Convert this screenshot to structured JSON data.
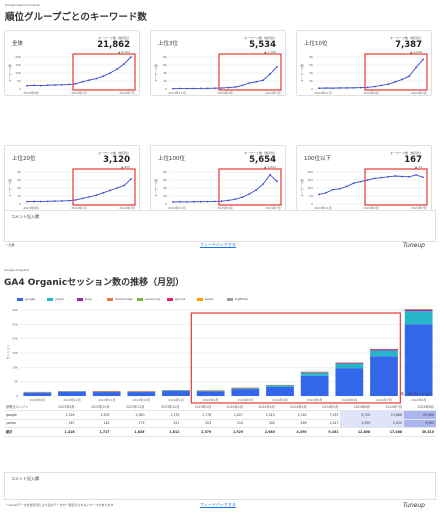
{
  "top": {
    "tag": "Google Search Console",
    "title": "順位グループごとのキーワード数",
    "comment_label": "コメント記入欄",
    "footnote": "* 出典",
    "feedback": "フィードバックする",
    "logo": "Tuneup"
  },
  "cards": [
    {
      "title": "全体",
      "kpi_label": "キーワード数（前月比）",
      "value": "21,862",
      "delta": "▲ 6,253",
      "ylabel": "キーワード数",
      "xticks": [
        "2023年8月",
        "2024年1月",
        "2024年7月"
      ],
      "yticks": [
        "20K",
        "15K",
        "10K",
        "5K",
        "0"
      ]
    },
    {
      "title": "上位3位",
      "kpi_label": "キーワード数（前月比）",
      "value": "5,534",
      "delta": "▲ 1,785",
      "ylabel": "キーワード数",
      "xticks": [
        "2023年11月",
        "2024年3月",
        "2024年7月"
      ],
      "yticks": [
        "8K",
        "6K",
        "4K",
        "2K",
        "0"
      ]
    },
    {
      "title": "上位10位",
      "kpi_label": "キーワード数（前月比）",
      "value": "7,387",
      "delta": "▲ 1,998",
      "ylabel": "キーワード数",
      "xticks": [
        "2023年11月",
        "2024年3月",
        "2024年7月"
      ],
      "yticks": [
        "8K",
        "6K",
        "4K",
        "2K",
        "0"
      ]
    },
    {
      "title": "上位20位",
      "kpi_label": "キーワード数（前月比）",
      "value": "3,120",
      "delta": "▲ 815",
      "ylabel": "キーワード数",
      "xticks": [
        "2023年8月",
        "2024年1月",
        "2024年7月"
      ],
      "yticks": [
        "4K",
        "3K",
        "2K",
        "1K",
        "0"
      ]
    },
    {
      "title": "上位100位",
      "kpi_label": "キーワード数（前月比）",
      "value": "5,654",
      "delta": "▲ 1,641",
      "ylabel": "キーワード数",
      "xticks": [
        "2023年11月",
        "2024年3月",
        "2024年7月"
      ],
      "yticks": [
        "8K",
        "6K",
        "4K",
        "2K",
        "0"
      ]
    },
    {
      "title": "100位以下",
      "kpi_label": "キーワード数（前月比）",
      "value": "167",
      "delta": "▲ 15",
      "ylabel": "キーワード数",
      "xticks": [
        "2023年11月",
        "2024年3月",
        "2024年7月"
      ],
      "yticks": [
        "200",
        "150",
        "100",
        "50",
        "0"
      ]
    }
  ],
  "chart_data": [
    {
      "type": "line",
      "title": "全体",
      "ylim": [
        0,
        20000
      ],
      "values": [
        2000,
        2300,
        2100,
        2400,
        2500,
        2600,
        2800,
        3200,
        4500,
        5600,
        6500,
        8000,
        10000,
        12500,
        15600,
        21862
      ]
    },
    {
      "type": "line",
      "title": "上位3位",
      "ylim": [
        0,
        8000
      ],
      "values": [
        100,
        120,
        110,
        130,
        150,
        160,
        200,
        250,
        350,
        500,
        900,
        1500,
        1800,
        2200,
        3749,
        5534
      ]
    },
    {
      "type": "line",
      "title": "上位10位",
      "ylim": [
        0,
        8000
      ],
      "values": [
        200,
        250,
        220,
        260,
        280,
        300,
        350,
        400,
        600,
        900,
        1200,
        1800,
        2400,
        3200,
        5389,
        7387
      ]
    },
    {
      "type": "line",
      "title": "上位20位",
      "ylim": [
        0,
        4000
      ],
      "values": [
        300,
        320,
        310,
        330,
        360,
        380,
        420,
        500,
        700,
        900,
        1100,
        1400,
        1700,
        2000,
        2305,
        3120
      ]
    },
    {
      "type": "line",
      "title": "上位100位",
      "ylim": [
        0,
        8000
      ],
      "values": [
        500,
        550,
        520,
        560,
        580,
        600,
        650,
        700,
        900,
        1200,
        1700,
        2500,
        3500,
        5000,
        7295,
        5654
      ]
    },
    {
      "type": "line",
      "title": "100位以下",
      "ylim": [
        0,
        200
      ],
      "values": [
        60,
        70,
        90,
        95,
        110,
        130,
        140,
        150,
        160,
        165,
        170,
        175,
        172,
        170,
        182,
        167
      ]
    },
    {
      "type": "bar",
      "title": "GA4 Organicセッション数の推移（月別）",
      "categories": [
        "2023年9月",
        "2023年10月",
        "2023年11月",
        "2023年12月",
        "2024年1月",
        "2024年2月",
        "2024年3月",
        "2024年4月",
        "2024年5月",
        "2024年6月",
        "2024年7月",
        "2024年8月"
      ],
      "ylim": [
        0,
        30000
      ],
      "yticks": [
        "30K",
        "25K",
        "20K",
        "15K",
        "10K",
        "5K",
        "0"
      ],
      "ylabel": "セッション",
      "series": [
        {
          "name": "google",
          "color": "#3366e8",
          "values": [
            1159,
            1503,
            1380,
            1375,
            1778,
            1627,
            2415,
            3183,
            7033,
            9720,
            13866,
            25000
          ]
        },
        {
          "name": "yahoo",
          "color": "#26b5c9",
          "values": [
            167,
            142,
            175,
            151,
            203,
            224,
            300,
            489,
            1047,
            1559,
            2020,
            4593
          ]
        },
        {
          "name": "bing",
          "color": "#9c27b0",
          "values": [
            50,
            50,
            40,
            50,
            60,
            60,
            80,
            120,
            250,
            300,
            400,
            500
          ]
        },
        {
          "name": "duckduckgo",
          "color": "#e07b39",
          "values": [
            10,
            10,
            10,
            10,
            10,
            10,
            10,
            10,
            20,
            20,
            20,
            30
          ]
        },
        {
          "name": "ecosia.org",
          "color": "#7cb342",
          "values": [
            5,
            5,
            5,
            5,
            5,
            5,
            5,
            5,
            10,
            10,
            10,
            10
          ]
        },
        {
          "name": "goo.ne",
          "color": "#e91e63",
          "values": [
            20,
            20,
            20,
            20,
            20,
            20,
            30,
            40,
            60,
            80,
            90,
            120
          ]
        },
        {
          "name": "baidu",
          "color": "#ff9800",
          "values": [
            3,
            3,
            3,
            3,
            3,
            3,
            3,
            3,
            5,
            5,
            5,
            5
          ]
        },
        {
          "name": "bigfinder",
          "color": "#9e9e9e",
          "values": [
            2,
            2,
            2,
            2,
            2,
            2,
            2,
            2,
            3,
            3,
            3,
            3
          ]
        }
      ]
    }
  ],
  "bottom": {
    "tag": "Google Analytics",
    "title": "GA4 Organicセッション数の推移（月別）",
    "unit": "年、月 / セッション",
    "table_headers": [
      "参照元エンジン",
      "2023年9月",
      "2023年10月",
      "2023年11月",
      "2023年12月",
      "2024年1月",
      "2024年2月",
      "2024年3月",
      "2024年4月",
      "2024年5月",
      "2024年6月",
      "2024年7月",
      "2024年8月"
    ],
    "table_rows": [
      [
        "google",
        "1,159",
        "1,503",
        "1,380",
        "1,375",
        "1,778",
        "1,627",
        "2,415",
        "3,183",
        "7,033",
        "9,720",
        "13,866",
        "25,000"
      ],
      [
        "yahoo",
        "167",
        "142",
        "175",
        "151",
        "203",
        "224",
        "300",
        "489",
        "1,047",
        "1,559",
        "2,020",
        "4,593"
      ],
      [
        "総計",
        "1,418",
        "1,727",
        "1,626",
        "1,612",
        "2,079",
        "1,929",
        "2,980",
        "4,390",
        "9,161",
        "12,808",
        "17,468",
        "30,510"
      ]
    ],
    "comment_label": "コメント記入欄",
    "footnote": "* GA4のデータ仕様状況により表のデータが一部表示されないケースがあります",
    "feedback": "フィードバックする",
    "logo": "Tuneup"
  }
}
